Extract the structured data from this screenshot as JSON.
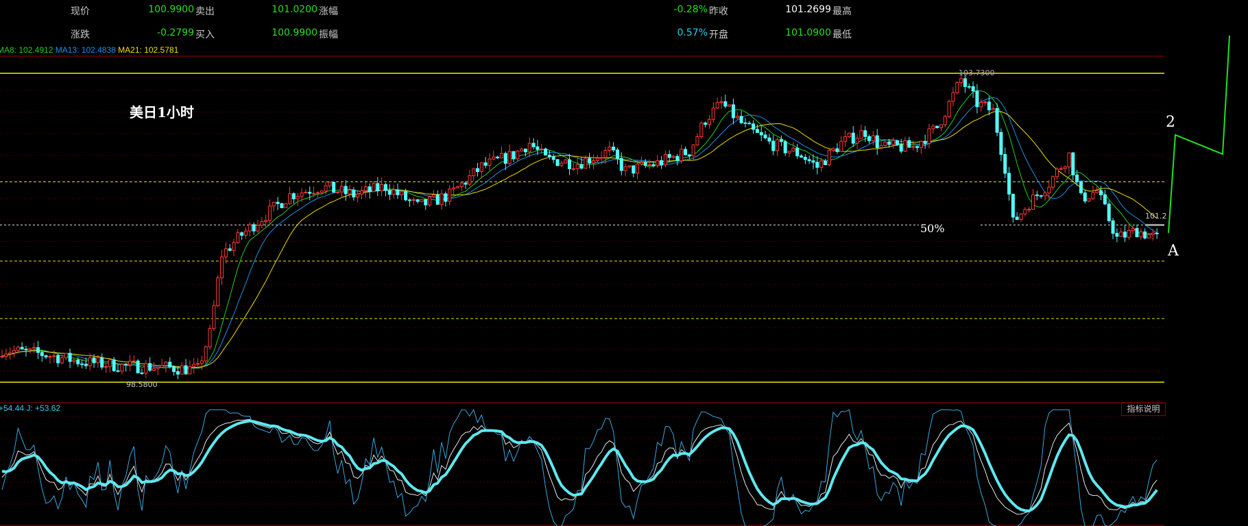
{
  "quote": {
    "row1": [
      {
        "label": "现价",
        "value": "",
        "color": "#ccc"
      },
      {
        "label": "卖出",
        "value": "100.9900",
        "color": "#22e022"
      },
      {
        "label": "涨幅",
        "value": "101.0200",
        "color": "#22e022"
      },
      {
        "label": "昨收",
        "value": "-0.28%",
        "color": "#22e022"
      },
      {
        "label": "最高",
        "value": "101.2699",
        "color": "#ffffff"
      }
    ],
    "row2": [
      {
        "label": "涨跌",
        "value": "",
        "color": "#ccc"
      },
      {
        "label": "买入",
        "value": "-0.2799",
        "color": "#22e022"
      },
      {
        "label": "振幅",
        "value": "100.9900",
        "color": "#22e022"
      },
      {
        "label": "开盘",
        "value": "0.57%",
        "color": "#22d0f0"
      },
      {
        "label": "最低",
        "value": "101.0900",
        "color": "#22e022"
      }
    ]
  },
  "ma": {
    "ma8": "MA8: 102.4912",
    "ma13": "MA13: 102.4838",
    "ma21": "MA21: 102.5781",
    "colors": {
      "ma8": "#22d022",
      "ma13": "#1e90e8",
      "ma21": "#f0e000"
    }
  },
  "annotations": {
    "title": "美日1小时",
    "fifty": "50%",
    "label2": "2",
    "labelA": "A",
    "high": "103.7300",
    "low": "98.5800",
    "last": "101.2"
  },
  "kdj": {
    "header": "+54.44  J: +53.62",
    "help_button": "指标说明"
  },
  "chart_data": {
    "type": "candlestick",
    "ylim": [
      98.58,
      103.73
    ],
    "anchors_index": [
      0,
      10,
      20,
      30,
      40,
      49,
      52,
      55,
      60,
      66,
      72,
      80,
      88,
      96,
      104,
      112,
      120,
      128,
      132,
      136,
      144,
      152,
      156,
      164,
      172,
      176,
      180,
      186,
      192,
      200,
      204,
      210,
      216,
      220,
      228,
      234,
      238,
      240,
      244,
      248,
      251,
      253,
      257,
      262,
      267,
      270,
      274,
      279,
      284,
      289
    ],
    "anchors_price": [
      99.12,
      99.05,
      98.92,
      98.85,
      98.83,
      98.79,
      99.39,
      100.71,
      101.04,
      101.37,
      101.7,
      101.84,
      101.7,
      101.84,
      101.51,
      101.7,
      102.17,
      102.37,
      102.57,
      102.3,
      102.23,
      102.43,
      102.1,
      102.23,
      102.43,
      102.96,
      103.23,
      102.83,
      102.57,
      102.37,
      102.17,
      102.57,
      102.76,
      102.5,
      102.5,
      102.83,
      103.36,
      103.63,
      103.23,
      103.1,
      102.17,
      101.24,
      101.57,
      101.9,
      102.37,
      101.64,
      101.77,
      100.98,
      101.11,
      100.98
    ],
    "levels": [
      103.73,
      101.92,
      101.2,
      100.6,
      99.64,
      98.58
    ]
  }
}
